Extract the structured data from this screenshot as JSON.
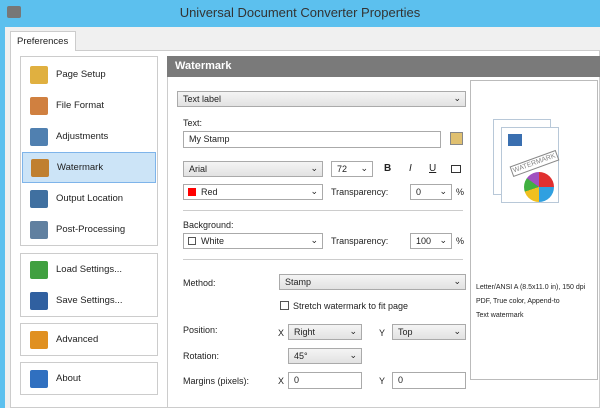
{
  "window": {
    "title": "Universal Document Converter Properties"
  },
  "tabs": [
    {
      "label": "Preferences"
    }
  ],
  "sidebar": {
    "items": [
      {
        "label": "Page Setup",
        "icon": "page-setup-icon",
        "color": "#e0b040"
      },
      {
        "label": "File Format",
        "icon": "file-format-icon",
        "color": "#d08040"
      },
      {
        "label": "Adjustments",
        "icon": "adjustments-icon",
        "color": "#5080b0"
      },
      {
        "label": "Watermark",
        "icon": "watermark-icon",
        "color": "#c08030",
        "selected": true
      },
      {
        "label": "Output Location",
        "icon": "output-location-icon",
        "color": "#4070a0"
      },
      {
        "label": "Post-Processing",
        "icon": "post-processing-icon",
        "color": "#6080a0"
      }
    ],
    "settings": [
      {
        "label": "Load Settings...",
        "icon": "load-settings-icon",
        "color": "#40a040"
      },
      {
        "label": "Save Settings...",
        "icon": "save-settings-icon",
        "color": "#3060a0"
      }
    ],
    "advanced": {
      "label": "Advanced",
      "icon": "gears-icon",
      "color": "#e09020"
    },
    "about": {
      "label": "About",
      "icon": "question-icon",
      "color": "#3070c0"
    }
  },
  "panel": {
    "header": "Watermark",
    "type": "Text label",
    "text_label": "Text:",
    "text_value": "My Stamp",
    "font": "Arial",
    "size": "72",
    "bold": "B",
    "italic": "I",
    "underline": "U",
    "color": "Red",
    "color_hex": "#ff0000",
    "transparency_label": "Transparency:",
    "transparency": "0",
    "pct": "%",
    "background_label": "Background:",
    "background": "White",
    "bg_transparency": "100",
    "method_label": "Method:",
    "method": "Stamp",
    "stretch_label": "Stretch watermark to fit page",
    "position_label": "Position:",
    "x_label": "X",
    "y_label": "Y",
    "pos_x": "Right",
    "pos_y": "Top",
    "rotation_label": "Rotation:",
    "rotation": "45°",
    "margins_label": "Margins (pixels):",
    "margin_x": "0",
    "margin_y": "0"
  },
  "preview": {
    "stamp": "WATERMARK",
    "info": [
      "Letter/ANSI A (8.5x11.0 in), 150 dpi",
      "PDF, True color, Append-to",
      "Text watermark"
    ]
  }
}
